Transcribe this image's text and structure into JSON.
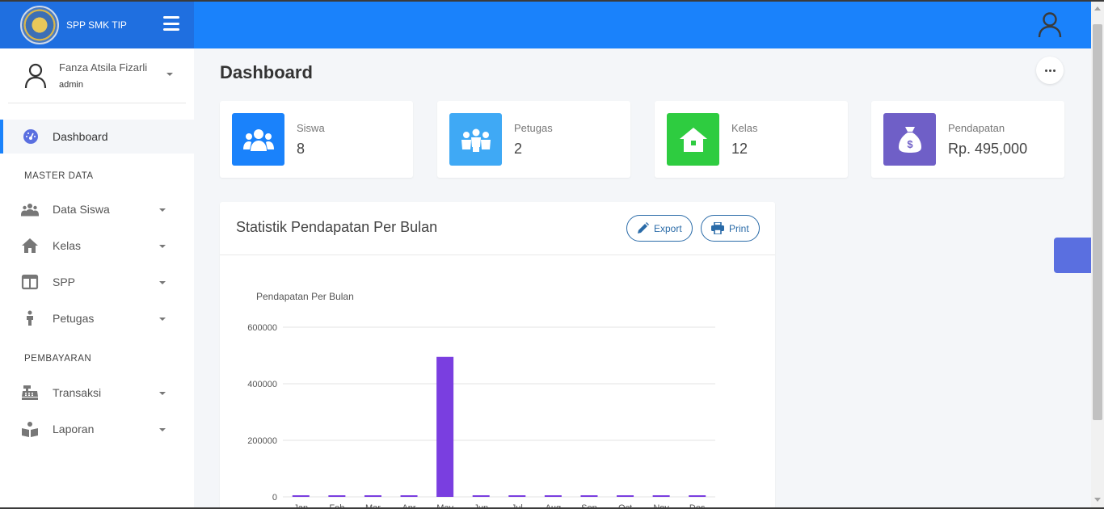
{
  "brand": {
    "title": "SPP SMK TIP"
  },
  "user": {
    "name": "Fanza Atsila Fizarli",
    "role": "admin"
  },
  "sidebar": {
    "dashboard_label": "Dashboard",
    "sections": {
      "master": "MASTER DATA",
      "pembayaran": "PEMBAYARAN"
    },
    "master_items": [
      {
        "label": "Data Siswa",
        "icon": "users-icon"
      },
      {
        "label": "Kelas",
        "icon": "home-icon"
      },
      {
        "label": "SPP",
        "icon": "table-icon"
      },
      {
        "label": "Petugas",
        "icon": "person-icon"
      }
    ],
    "pembayaran_items": [
      {
        "label": "Transaksi",
        "icon": "cash-register-icon"
      },
      {
        "label": "Laporan",
        "icon": "book-reader-icon"
      }
    ]
  },
  "main": {
    "title": "Dashboard",
    "cards": [
      {
        "label": "Siswa",
        "value": "8",
        "color": "#1a82fb",
        "icon": "users-icon"
      },
      {
        "label": "Petugas",
        "value": "2",
        "color": "#3fa9f5",
        "icon": "people-group-icon"
      },
      {
        "label": "Kelas",
        "value": "12",
        "color": "#2ecc40",
        "icon": "home-icon"
      },
      {
        "label": "Pendapatan",
        "value": "Rp. 495,000",
        "color": "#6f5fc7",
        "icon": "money-bag-icon"
      }
    ],
    "panel": {
      "title": "Statistik Pendapatan Per Bulan",
      "export_label": "Export",
      "print_label": "Print"
    }
  },
  "chart_data": {
    "type": "bar",
    "title": "Pendapatan Per Bulan",
    "categories": [
      "Jan",
      "Feb",
      "Mar",
      "Apr",
      "May",
      "Jun",
      "Jul",
      "Aug",
      "Sep",
      "Oct",
      "Nov",
      "Des"
    ],
    "values": [
      0,
      0,
      0,
      0,
      495000,
      0,
      0,
      0,
      0,
      0,
      0,
      0
    ],
    "yticks": [
      0,
      200000,
      400000,
      600000
    ],
    "ylim": [
      0,
      600000
    ],
    "grid": true,
    "color": "#7a3ee0"
  }
}
